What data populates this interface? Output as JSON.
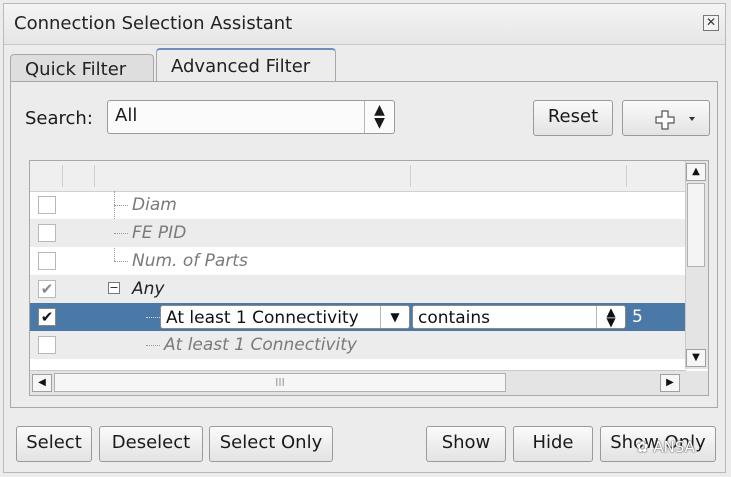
{
  "window": {
    "title": "Connection Selection Assistant"
  },
  "tabs": [
    {
      "label": "Quick Filter"
    },
    {
      "label": "Advanced Filter",
      "active": true
    }
  ],
  "search": {
    "label": "Search:",
    "value": "All"
  },
  "toolbar": {
    "reset_label": "Reset"
  },
  "tree": {
    "rows": [
      {
        "label": "Diam",
        "checked": false
      },
      {
        "label": "FE PID",
        "checked": false
      },
      {
        "label": "Num. of Parts",
        "checked": false
      },
      {
        "label": "Any",
        "checked": true,
        "expanded": true
      },
      {
        "field": "At least 1 Connectivity",
        "operator": "contains",
        "value": "5",
        "checked": true,
        "selected": true
      },
      {
        "label": "At least 1 Connectivity",
        "checked": false
      }
    ],
    "hscroll_grip": "III"
  },
  "footer": {
    "select_label": "Select",
    "deselect_label": "Deselect",
    "select_only_label": "Select Only",
    "show_label": "Show",
    "hide_label": "Hide",
    "show_only_label": "Show Only"
  },
  "watermark": "ANSA",
  "colors": {
    "selection": "#4a79a8",
    "tab_accent": "#6a8fbf"
  }
}
